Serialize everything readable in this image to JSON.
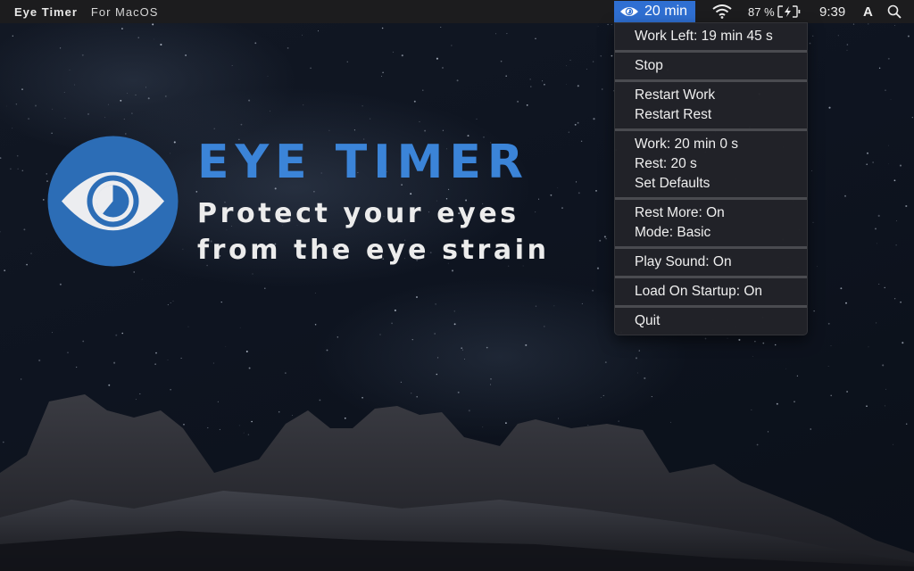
{
  "menubar": {
    "app_name": "Eye Timer",
    "app_subtitle": "For MacOS",
    "status_timer": {
      "icon": "eye-icon",
      "label": "20 min",
      "color": "#2f6fd2"
    },
    "wifi": {
      "icon": "wifi-icon"
    },
    "battery": {
      "percent_label": "87 %",
      "icon": "battery-charging-icon"
    },
    "clock": "9:39",
    "input_source": "A",
    "spotlight": {
      "icon": "search-icon"
    }
  },
  "dropdown": {
    "groups": [
      {
        "items": [
          {
            "label": "Work Left:  19 min 45 s"
          }
        ]
      },
      {
        "items": [
          {
            "label": "Stop"
          }
        ]
      },
      {
        "items": [
          {
            "label": "Restart Work"
          },
          {
            "label": "Restart Rest"
          }
        ]
      },
      {
        "items": [
          {
            "label": "Work: 20 min 0 s"
          },
          {
            "label": "Rest: 20 s"
          },
          {
            "label": "Set Defaults"
          }
        ]
      },
      {
        "items": [
          {
            "label": "Rest More: On"
          },
          {
            "label": "Mode: Basic"
          }
        ]
      },
      {
        "items": [
          {
            "label": "Play Sound: On"
          }
        ]
      },
      {
        "items": [
          {
            "label": "Load On Startup: On"
          }
        ]
      },
      {
        "items": [
          {
            "label": "Quit"
          }
        ]
      }
    ]
  },
  "hero": {
    "logo_icon": "eye-timer-logo-icon",
    "title": "EYE TIMER",
    "tagline_line1": "Protect your eyes",
    "tagline_line2": "from the eye strain",
    "brand_color": "#3b84d8"
  }
}
